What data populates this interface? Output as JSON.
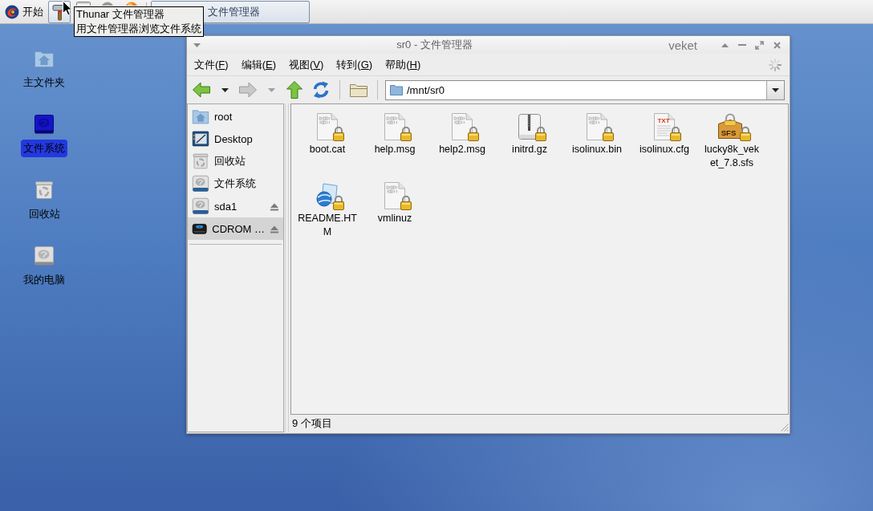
{
  "taskbar": {
    "start_button": {
      "label": "开始"
    },
    "launchers": [
      {
        "kind": "hammer",
        "hovered": true
      },
      {
        "kind": "window",
        "hovered": false
      },
      {
        "kind": "disc",
        "hovered": false
      },
      {
        "kind": "ball",
        "hovered": false
      }
    ],
    "window_buttons": [
      {
        "label": "文件管理器",
        "selected": true
      }
    ]
  },
  "tooltip": {
    "title": "Thunar 文件管理器",
    "text": "用文件管理器浏览文件系统"
  },
  "desktop": {
    "icons": [
      {
        "label": "主文件夹",
        "kind": "home",
        "selected": false
      },
      {
        "label": "文件系统",
        "kind": "drive",
        "selected": true
      },
      {
        "label": "回收站",
        "kind": "trash",
        "selected": false
      },
      {
        "label": "我的电脑",
        "kind": "drive",
        "selected": false
      }
    ]
  },
  "window": {
    "title": "sr0 - 文件管理器",
    "theme_label": "veket",
    "menu": [
      {
        "label_start": "文件(",
        "access_key": "F",
        "label_end": ")"
      },
      {
        "label_start": "编辑(",
        "access_key": "E",
        "label_end": ")"
      },
      {
        "label_start": "视图(",
        "access_key": "V",
        "label_end": ")"
      },
      {
        "label_start": "转到(",
        "access_key": "G",
        "label_end": ")"
      },
      {
        "label_start": "帮助(",
        "access_key": "H",
        "label_end": ")"
      }
    ],
    "toolbar": [
      {
        "kind": "back",
        "disabled": false
      },
      {
        "kind": "history_menu",
        "disabled": false
      },
      {
        "kind": "forward",
        "disabled": true
      },
      {
        "kind": "history_menu",
        "disabled": true
      },
      {
        "kind": "up",
        "disabled": false
      },
      {
        "kind": "reload",
        "disabled": false
      },
      {
        "kind": "separator"
      },
      {
        "kind": "folder",
        "disabled": false
      },
      {
        "kind": "separator"
      }
    ],
    "location": {
      "value": "/mnt/sr0"
    },
    "sidebar": {
      "items": [
        {
          "label": "root",
          "kind": "home",
          "selected": false,
          "ejectable": false
        },
        {
          "label": "Desktop",
          "kind": "desktop",
          "selected": false,
          "ejectable": false
        },
        {
          "label": "回收站",
          "kind": "trash",
          "selected": false,
          "ejectable": false
        },
        {
          "label": "文件系统",
          "kind": "drive",
          "selected": false,
          "ejectable": false
        },
        {
          "label": "sda1",
          "kind": "drive",
          "selected": false,
          "ejectable": true
        },
        {
          "label": "CDROM …",
          "kind": "cdrom",
          "selected": true,
          "ejectable": true
        }
      ]
    },
    "files": [
      {
        "name": "boot.cat",
        "kind": "binary",
        "locked": true,
        "selected": false
      },
      {
        "name": "help.msg",
        "kind": "binary",
        "locked": true,
        "selected": false
      },
      {
        "name": "help2.msg",
        "kind": "binary",
        "locked": true,
        "selected": false
      },
      {
        "name": "initrd.gz",
        "kind": "archive",
        "locked": true,
        "selected": false
      },
      {
        "name": "isolinux.bin",
        "kind": "binary",
        "locked": true,
        "selected": false
      },
      {
        "name": "isolinux.cfg",
        "kind": "text",
        "icon_text": "TXT",
        "locked": true,
        "selected": false
      },
      {
        "name": "lucky8k_veket_7.8.sfs",
        "kind": "package",
        "icon_text": "SFS",
        "locked": true,
        "selected": false
      },
      {
        "name": "README.HTM",
        "kind": "html",
        "locked": true,
        "selected": false
      },
      {
        "name": "vmlinuz",
        "kind": "binary",
        "locked": true,
        "selected": false
      }
    ],
    "status_bar": {
      "text": "9 个项目"
    }
  }
}
